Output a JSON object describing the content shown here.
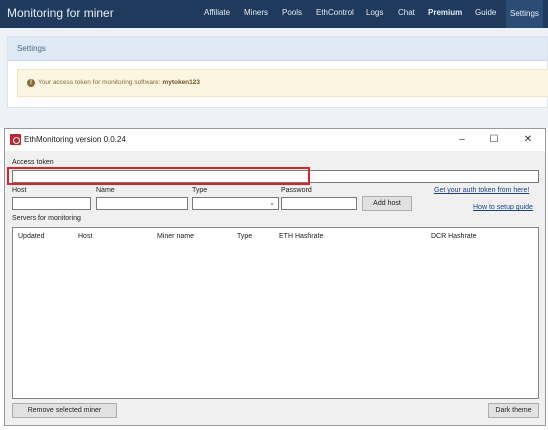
{
  "website": {
    "brand": "Monitoring for miner",
    "nav": [
      "Affiliate",
      "Miners",
      "Pools",
      "EthControl",
      "Logs",
      "Chat",
      "Premium",
      "Guide",
      "Settings"
    ],
    "panel_title": "Settings",
    "alert_prefix": "Your access token for monitoring software:",
    "alert_token": "mytoken123"
  },
  "window": {
    "title": "EthMonitoring version 0.0.24",
    "controls": {
      "minimize": "–",
      "maximize": "☐",
      "close": "✕"
    },
    "access_token_label": "Access token",
    "access_token_value": "",
    "host_label": "Host",
    "name_label": "Name",
    "type_label": "Type",
    "password_label": "Password",
    "add_host_button": "Add host",
    "auth_link": "Get your auth token from here!",
    "guide_link": "How to setup guide",
    "servers_label": "Servers for monitoring",
    "columns": [
      "Updated",
      "Host",
      "Miner name",
      "Type",
      "ETH Hashrate",
      "DCR Hashrate"
    ],
    "remove_button": "Remove selected miner",
    "theme_button": "Dark theme"
  }
}
